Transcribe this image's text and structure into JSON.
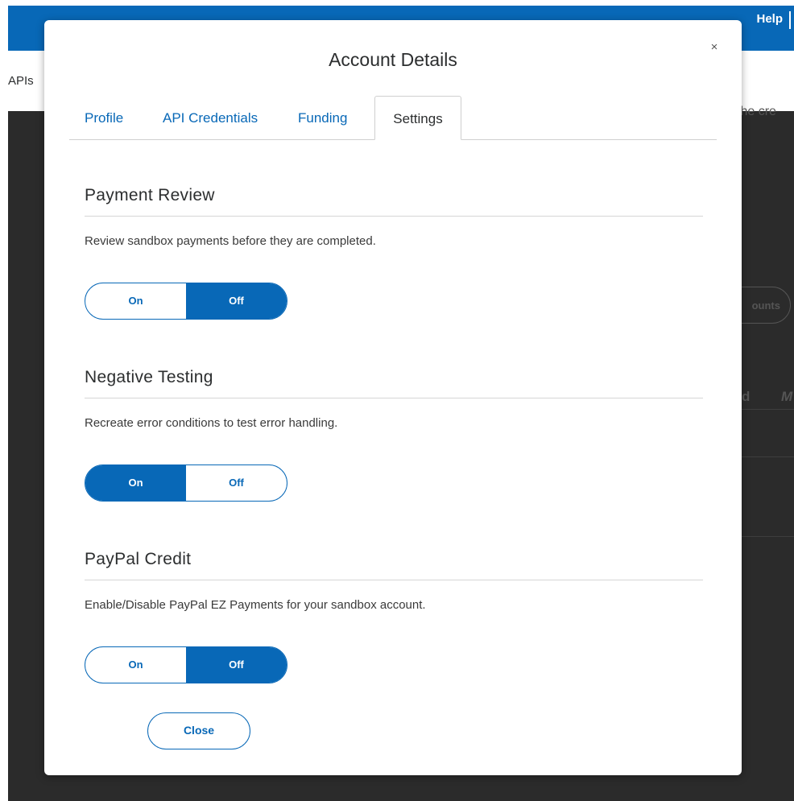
{
  "background": {
    "help_label": "Help",
    "apis_label": "APIs",
    "partial_text": "the cre",
    "accounts_button_partial": "ounts",
    "column_partial_d": "d",
    "column_partial_m": "M"
  },
  "modal": {
    "title": "Account Details",
    "close_icon_glyph": "×",
    "tabs": [
      {
        "label": "Profile",
        "active": false
      },
      {
        "label": "API Credentials",
        "active": false
      },
      {
        "label": "Funding",
        "active": false
      },
      {
        "label": "Settings",
        "active": true
      }
    ],
    "sections": [
      {
        "title": "Payment Review",
        "description": "Review sandbox payments before they are completed.",
        "on_label": "On",
        "off_label": "Off",
        "selected": "Off"
      },
      {
        "title": "Negative Testing",
        "description": "Recreate error conditions to test error handling.",
        "on_label": "On",
        "off_label": "Off",
        "selected": "On"
      },
      {
        "title": "PayPal Credit",
        "description": "Enable/Disable PayPal EZ Payments for your sandbox account.",
        "on_label": "On",
        "off_label": "Off",
        "selected": "Off"
      }
    ],
    "close_button_label": "Close"
  },
  "colors": {
    "brand_blue": "#0868b7",
    "overlay_dark": "#2b2b2b"
  }
}
